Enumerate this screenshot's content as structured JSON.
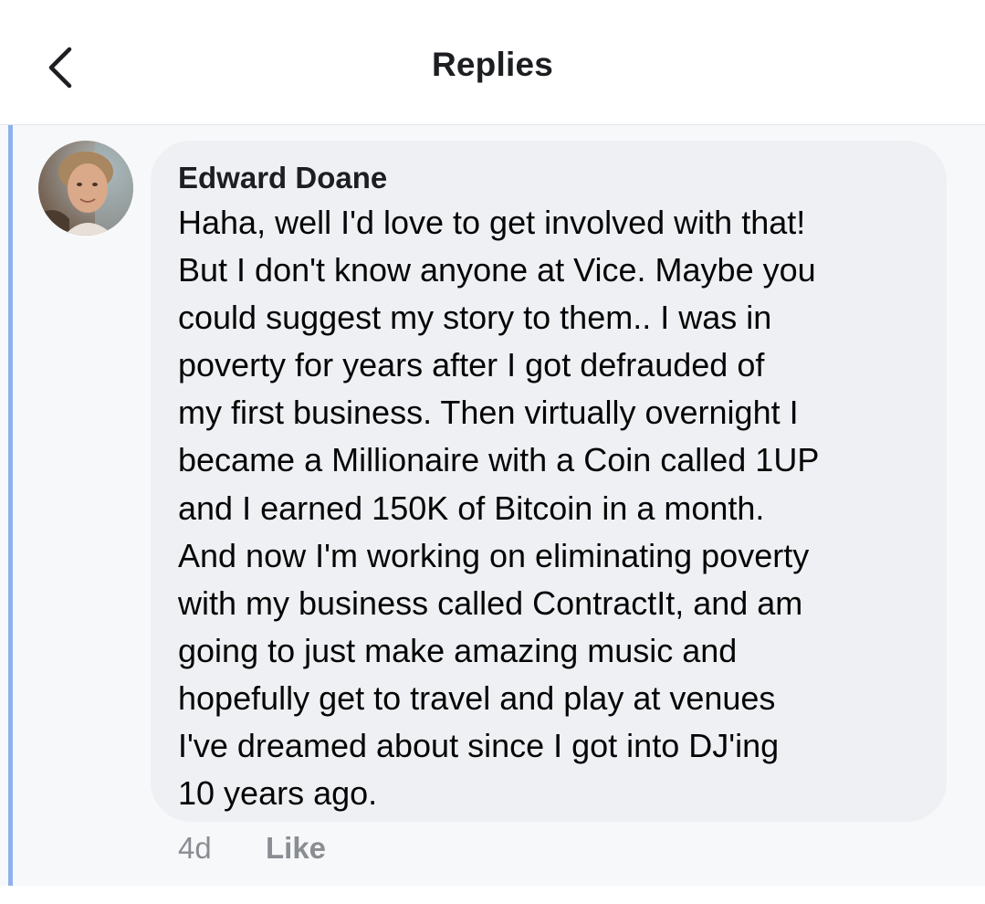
{
  "header": {
    "title": "Replies",
    "back_icon": "chevron-left-icon"
  },
  "comment": {
    "author": "Edward Doane",
    "avatar": "avatar-photo",
    "text_lines": [
      "Haha, well I'd love to get involved with that!",
      "But I don't know anyone at Vice. Maybe you",
      "could suggest my story to them.. I was in",
      "poverty for years after I got defrauded of",
      "my first business. Then virtually overnight I",
      "became a Millionaire with a Coin called 1UP",
      "and I earned 150K of Bitcoin in a month.",
      "And now I'm working on eliminating poverty",
      "with my business called ContractIt, and am",
      "going to just make amazing music and",
      "hopefully get to travel and play at venues",
      "I've dreamed about since I got into DJ'ing",
      "10 years ago."
    ],
    "time": "4d",
    "like_label": "Like"
  },
  "colors": {
    "thread_line": "#8fb0ec",
    "bubble": "#eff0f3",
    "meta_text": "#8a8d91",
    "thread_background": "#f7f8fa"
  }
}
